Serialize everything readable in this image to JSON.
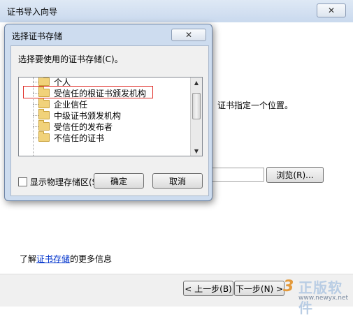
{
  "wizard": {
    "title": "证书导入向导",
    "close_glyph": "✕",
    "description": "证书指定一个位置。",
    "browse_label": "浏览(R)...",
    "learn_more_prefix": "了解",
    "learn_more_link": "证书存储",
    "learn_more_suffix": "的更多信息",
    "back_label": "< 上一步(B)",
    "next_label": "下一步(N) >"
  },
  "dialog": {
    "title": "选择证书存储",
    "close_glyph": "✕",
    "prompt": "选择要使用的证书存储(C)。",
    "stores": [
      {
        "label": "个人"
      },
      {
        "label": "受信任的根证书颁发机构"
      },
      {
        "label": "企业信任"
      },
      {
        "label": "中级证书颁发机构"
      },
      {
        "label": "受信任的发布者"
      },
      {
        "label": "不信任的证书"
      }
    ],
    "highlighted_index": 1,
    "show_physical_label": "显示物理存储区(S)",
    "show_physical_checked": false,
    "ok_label": "确定",
    "cancel_label": "取消"
  },
  "watermark": {
    "text": "正版软件",
    "url": "www.newyx.net",
    "logo": "3"
  },
  "colors": {
    "highlight_border": "#e0302a",
    "link": "#0033cc",
    "folder": "#f1d27a"
  }
}
